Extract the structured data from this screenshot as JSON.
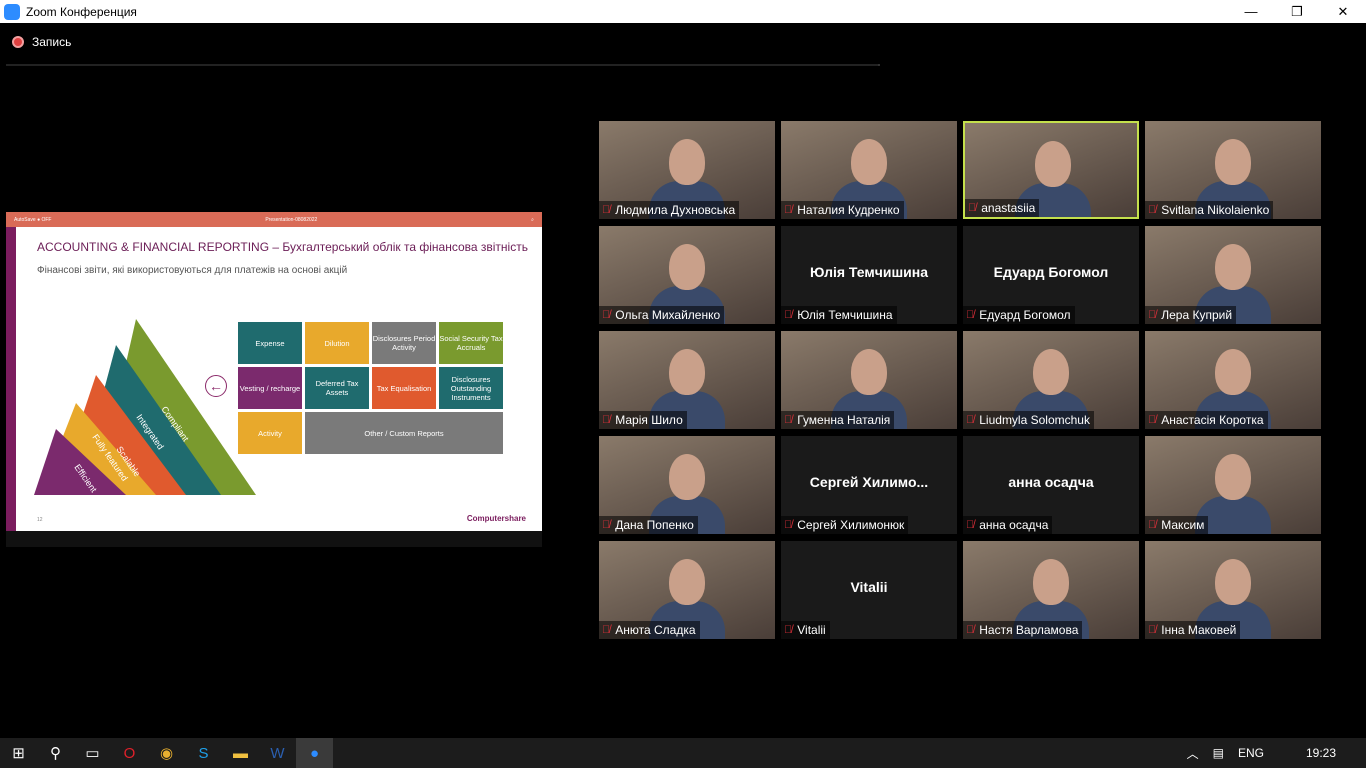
{
  "window": {
    "title": "Zoom Конференция",
    "minimize": "—",
    "maximize": "❐",
    "close": "✕"
  },
  "recording": {
    "label": "Запись"
  },
  "share": {
    "toolbar": {
      "autosave": "AutoSave ● OFF",
      "file": "Presentation-08082022"
    },
    "title": "ACCOUNTING & FINANCIAL REPORTING – Бухгалтерський облік та фінансова звітність",
    "subtitle": "Фінансові звіти, які використовуються для платежів на основі акцій",
    "pyramid": [
      "Efficient",
      "Fully featured",
      "Scalable",
      "Integrated",
      "Compliant"
    ],
    "cells": [
      {
        "label": "Expense",
        "color": "#1f6b6e"
      },
      {
        "label": "Dilution",
        "color": "#e8a92c"
      },
      {
        "label": "Disclosures Period Activity",
        "color": "#7a7a7a"
      },
      {
        "label": "Social Security Tax Accruals",
        "color": "#7a9a2e"
      },
      {
        "label": "Vesting / recharge",
        "color": "#7b2a6d"
      },
      {
        "label": "Deferred Tax Assets",
        "color": "#1f6b6e"
      },
      {
        "label": "Tax Equalisation",
        "color": "#e05a2e"
      },
      {
        "label": "Disclosures Outstanding Instruments",
        "color": "#1f6b6e"
      },
      {
        "label": "Activity",
        "color": "#e8a92c"
      },
      {
        "label": "Other / Custom Reports",
        "color": "#7a7a7a"
      }
    ],
    "brand": "Computershare",
    "page": "12"
  },
  "participants": [
    {
      "name": "Людмила Духновська",
      "video": true
    },
    {
      "name": "Наталия Кудренко",
      "video": true
    },
    {
      "name": "anastasiia",
      "video": true,
      "active": true
    },
    {
      "name": "Svitlana Nikolaienko",
      "video": true
    },
    {
      "name": "Ольга Михайленко",
      "video": true
    },
    {
      "name": "Юлія Темчишина",
      "video": false,
      "display": "Юлія Темчишина"
    },
    {
      "name": "Едуард Богомол",
      "video": false,
      "display": "Едуард Богомол"
    },
    {
      "name": "Лера Куприй",
      "video": true
    },
    {
      "name": "Марія Шило",
      "video": true
    },
    {
      "name": "Гуменна Наталія",
      "video": true
    },
    {
      "name": "Liudmyla Solomchuk",
      "video": true
    },
    {
      "name": "Анастасія Коротка",
      "video": true
    },
    {
      "name": "Дана Попенко",
      "video": true
    },
    {
      "name": "Сергей Хилимонюк",
      "video": false,
      "display": "Сергей  Хилимо..."
    },
    {
      "name": "анна осадча",
      "video": false,
      "display": "анна осадча"
    },
    {
      "name": "Максим",
      "video": true
    },
    {
      "name": "Анюта Сладка",
      "video": true
    },
    {
      "name": "Vitalii",
      "video": false,
      "display": "Vitalii"
    },
    {
      "name": "Настя Варламова",
      "video": true
    },
    {
      "name": "Інна Маковей",
      "video": true
    }
  ],
  "taskbar": {
    "apps": [
      "start-icon",
      "search-icon",
      "task-view-icon",
      "opera-icon",
      "chrome-icon",
      "skype-icon",
      "explorer-icon",
      "word-icon",
      "zoom-icon"
    ],
    "lang": "ENG",
    "time": "19:23"
  }
}
